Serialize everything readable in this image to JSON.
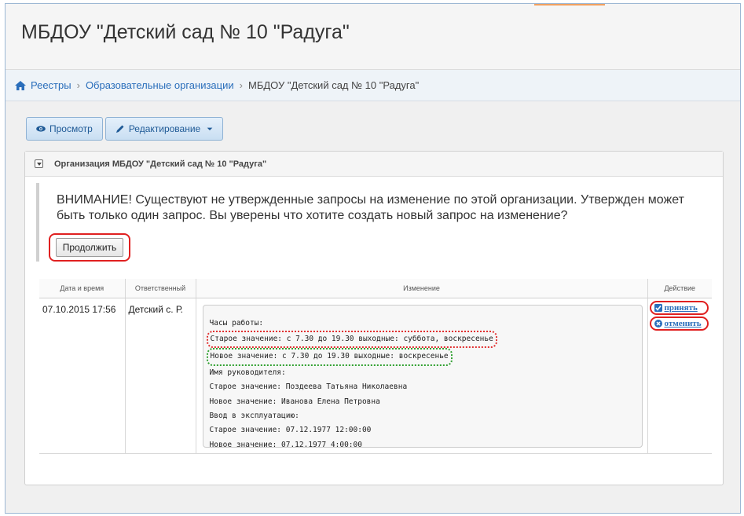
{
  "page": {
    "title": "МБДОУ \"Детский сад № 10 \"Радуга\""
  },
  "breadcrumb": {
    "items": [
      "Реестры",
      "Образовательные организации",
      "МБДОУ \"Детский сад № 10 \"Радуга\""
    ],
    "separator": "›"
  },
  "toolbar": {
    "view_label": "Просмотр",
    "edit_label": "Редактирование"
  },
  "panel": {
    "header": "Организация МБДОУ \"Детский сад № 10 \"Радуга\""
  },
  "warning": {
    "text": "ВНИМАНИЕ! Существуют не утвержденные запросы на изменение по этой организации. Утвержден может быть только один запрос. Вы уверены что хотите создать новый запрос на изменение?",
    "continue_label": "Продолжить"
  },
  "table": {
    "headers": [
      "Дата и время",
      "Ответственный",
      "Изменение",
      "Действие"
    ],
    "rows": [
      {
        "datetime": "07.10.2015 17:56",
        "responsible": "Детский с. Р.",
        "changes": [
          "Часы работы:",
          "Старое значение: с 7.30 до 19.30 выходные: суббота, воскресенье",
          "Новое значение: с 7.30 до 19.30 выходные: воскресенье",
          "Имя руководителя:",
          "Старое значение: Поздеева Татьяна Николаевна",
          "Новое значение: Иванова Елена Петровна",
          "Ввод в эксплуатацию:",
          "Старое значение: 07.12.1977 12:00:00",
          "Новое значение: 07.12.1977 4:00:00"
        ],
        "actions": {
          "accept": "принять",
          "cancel": "отменить"
        }
      }
    ]
  },
  "colors": {
    "link": "#2a6ebb",
    "highlight_red": "#e02020",
    "highlight_green": "#30a030"
  }
}
